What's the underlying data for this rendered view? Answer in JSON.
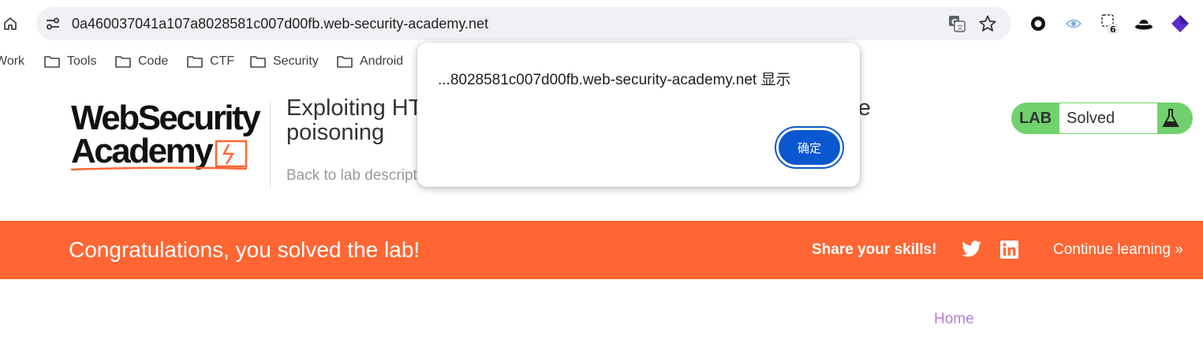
{
  "browser": {
    "url": "0a460037041a107a8028581c007d00fb.web-security-academy.net",
    "icons": [
      "home-icon",
      "site-info-icon",
      "translate-icon",
      "star-icon"
    ],
    "extensions": [
      {
        "name": "record-extension-icon"
      },
      {
        "name": "eye-extension-icon"
      },
      {
        "name": "badge-extension-icon",
        "badge": "6"
      },
      {
        "name": "hat-extension-icon"
      },
      {
        "name": "cube-extension-icon"
      }
    ],
    "bookmarks": [
      "Work",
      "Tools",
      "Code",
      "CTF",
      "Security",
      "Android"
    ]
  },
  "header": {
    "logo_line1": "WebSecurity",
    "logo_line2": "Academy",
    "lab_title": "Exploiting HTTP request smuggling to perform web cache poisoning",
    "back_link": "Back to lab description",
    "lab_badge": "LAB",
    "lab_status": "Solved",
    "status_color": "#70d16d"
  },
  "banner": {
    "message": "Congratulations, you solved the lab!",
    "share": "Share your skills!",
    "continue": "Continue learning",
    "continue_arrow": "»",
    "color": "#ff6633"
  },
  "nav": {
    "home": "Home"
  },
  "dialog": {
    "message": "...8028581c007d00fb.web-security-academy.net 显示",
    "ok": "确定",
    "button_color": "#0b57d0"
  }
}
